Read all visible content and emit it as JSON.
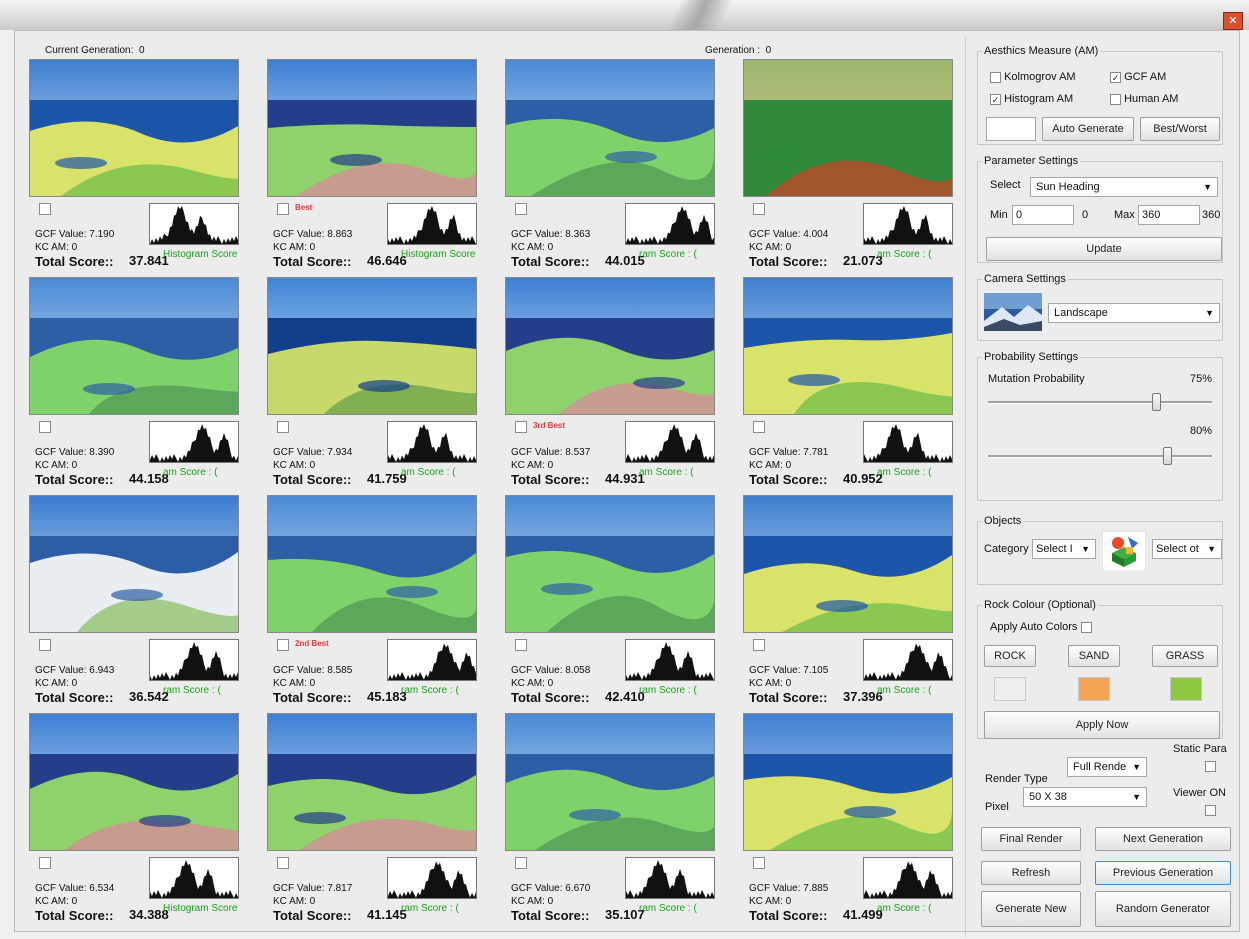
{
  "window": {
    "close_glyph": "✕"
  },
  "header": {
    "current_generation": "Current Generation:",
    "current_generation_value": "0",
    "generation": "Generation :",
    "generation_value": "0"
  },
  "cells": [
    {
      "gcf": "GCF Value: 7.190",
      "kc": "KC AM: 0",
      "total_label": "Total Score::",
      "total": "37.841",
      "hist_score": "Histogram Score : (",
      "rank": "",
      "scene": "sea"
    },
    {
      "gcf": "GCF Value: 8.863",
      "kc": "KC AM: 0",
      "total_label": "Total Score::",
      "total": "46.646",
      "hist_score": "Histogram Score : (",
      "rank": "Best",
      "scene": "pink"
    },
    {
      "gcf": "GCF Value: 8.363",
      "kc": "KC AM: 0",
      "total_label": "Total Score::",
      "total": "44.015",
      "hist_score": "ram Score : (",
      "rank": "",
      "scene": "green"
    },
    {
      "gcf": "GCF Value: 4.004",
      "kc": "KC AM: 0",
      "total_label": "Total Score::",
      "total": "21.073",
      "hist_score": "am Score : (",
      "rank": "",
      "scene": "red"
    },
    {
      "gcf": "GCF Value: 8.390",
      "kc": "KC AM: 0",
      "total_label": "Total Score::",
      "total": "44.158",
      "hist_score": "am Score : (",
      "rank": "",
      "scene": "green"
    },
    {
      "gcf": "GCF Value: 7.934",
      "kc": "KC AM: 0",
      "total_label": "Total Score::",
      "total": "41.759",
      "hist_score": "am Score : (",
      "rank": "",
      "scene": "island"
    },
    {
      "gcf": "GCF Value: 8.537",
      "kc": "KC AM: 0",
      "total_label": "Total Score::",
      "total": "44.931",
      "hist_score": "am Score : (",
      "rank": "3rd Best",
      "scene": "pink"
    },
    {
      "gcf": "GCF Value: 7.781",
      "kc": "KC AM: 0",
      "total_label": "Total Score::",
      "total": "40.952",
      "hist_score": "am Score : (",
      "rank": "",
      "scene": "sea"
    },
    {
      "gcf": "GCF Value: 6.943",
      "kc": "KC AM: 0",
      "total_label": "Total Score::",
      "total": "36.542",
      "hist_score": "ram Score : (",
      "rank": "",
      "scene": "snow"
    },
    {
      "gcf": "GCF Value: 8.585",
      "kc": "KC AM: 0",
      "total_label": "Total Score::",
      "total": "45.183",
      "hist_score": "ram Score : (",
      "rank": "2nd Best",
      "scene": "green"
    },
    {
      "gcf": "GCF Value: 8.058",
      "kc": "KC AM: 0",
      "total_label": "Total Score::",
      "total": "42.410",
      "hist_score": "ram Score : (",
      "rank": "",
      "scene": "green"
    },
    {
      "gcf": "GCF Value: 7.105",
      "kc": "KC AM: 0",
      "total_label": "Total Score::",
      "total": "37.396",
      "hist_score": "am Score : (",
      "rank": "",
      "scene": "sea"
    },
    {
      "gcf": "GCF Value: 6.534",
      "kc": "KC AM: 0",
      "total_label": "Total Score::",
      "total": "34.388",
      "hist_score": "Histogram Score : (",
      "rank": "",
      "scene": "pink"
    },
    {
      "gcf": "GCF Value: 7.817",
      "kc": "KC AM: 0",
      "total_label": "Total Score::",
      "total": "41.145",
      "hist_score": "ram Score : (",
      "rank": "",
      "scene": "pink"
    },
    {
      "gcf": "GCF Value: 6.670",
      "kc": "KC AM: 0",
      "total_label": "Total Score::",
      "total": "35.107",
      "hist_score": "ram Score : (",
      "rank": "",
      "scene": "green"
    },
    {
      "gcf": "GCF Value: 7.885",
      "kc": "KC AM: 0",
      "total_label": "Total Score::",
      "total": "41.499",
      "hist_score": "am Score : (",
      "rank": "",
      "scene": "sea"
    }
  ],
  "aesthetics": {
    "legend": "Aesthics Measure (AM)",
    "kolmogorov": "Kolmogrov AM",
    "kolmogorov_checked": false,
    "gcf": "GCF AM",
    "gcf_checked": true,
    "histogram": "Histogram AM",
    "histogram_checked": true,
    "human": "Human AM",
    "human_checked": false,
    "auto_generate": "Auto Generate",
    "best_worst": "Best/Worst"
  },
  "parameters": {
    "legend": "Parameter Settings",
    "select_label": "Select",
    "select_value": "Sun Heading",
    "min_label": "Min",
    "min_value": "0",
    "min_readout": "0",
    "max_label": "Max",
    "max_value": "360",
    "max_readout": "360",
    "update": "Update"
  },
  "camera": {
    "legend": "Camera Settings",
    "mode": "Landscape"
  },
  "probability": {
    "legend": "Probability Settings",
    "mutation_label": "Mutation Probability",
    "mutation_value": "75%",
    "mutation_fraction": 0.75,
    "second_value": "80%",
    "second_fraction": 0.8
  },
  "objects": {
    "legend": "Objects",
    "category_label": "Category",
    "category_value": "Select I",
    "object_value": "Select ot"
  },
  "rock": {
    "legend": "Rock Colour (Optional)",
    "auto_colors": "Apply Auto Colors",
    "rock": "ROCK",
    "sand": "SAND",
    "grass": "GRASS",
    "rock_color": "#eeeeee",
    "sand_color": "#f5a455",
    "grass_color": "#8dc63f",
    "apply_now": "Apply Now"
  },
  "render": {
    "render_type_label": "Render Type",
    "render_type_value": "Full Rende",
    "pixel_label": "Pixel",
    "pixel_value": "50 X 38",
    "static_para": "Static Para",
    "viewer_on": "Viewer ON"
  },
  "actions": {
    "final_render": "Final Render",
    "next_generation": "Next Generation",
    "refresh": "Refresh",
    "previous_generation": "Previous Generation",
    "generate_new": "Generate New",
    "random_generator": "Random Generator"
  }
}
